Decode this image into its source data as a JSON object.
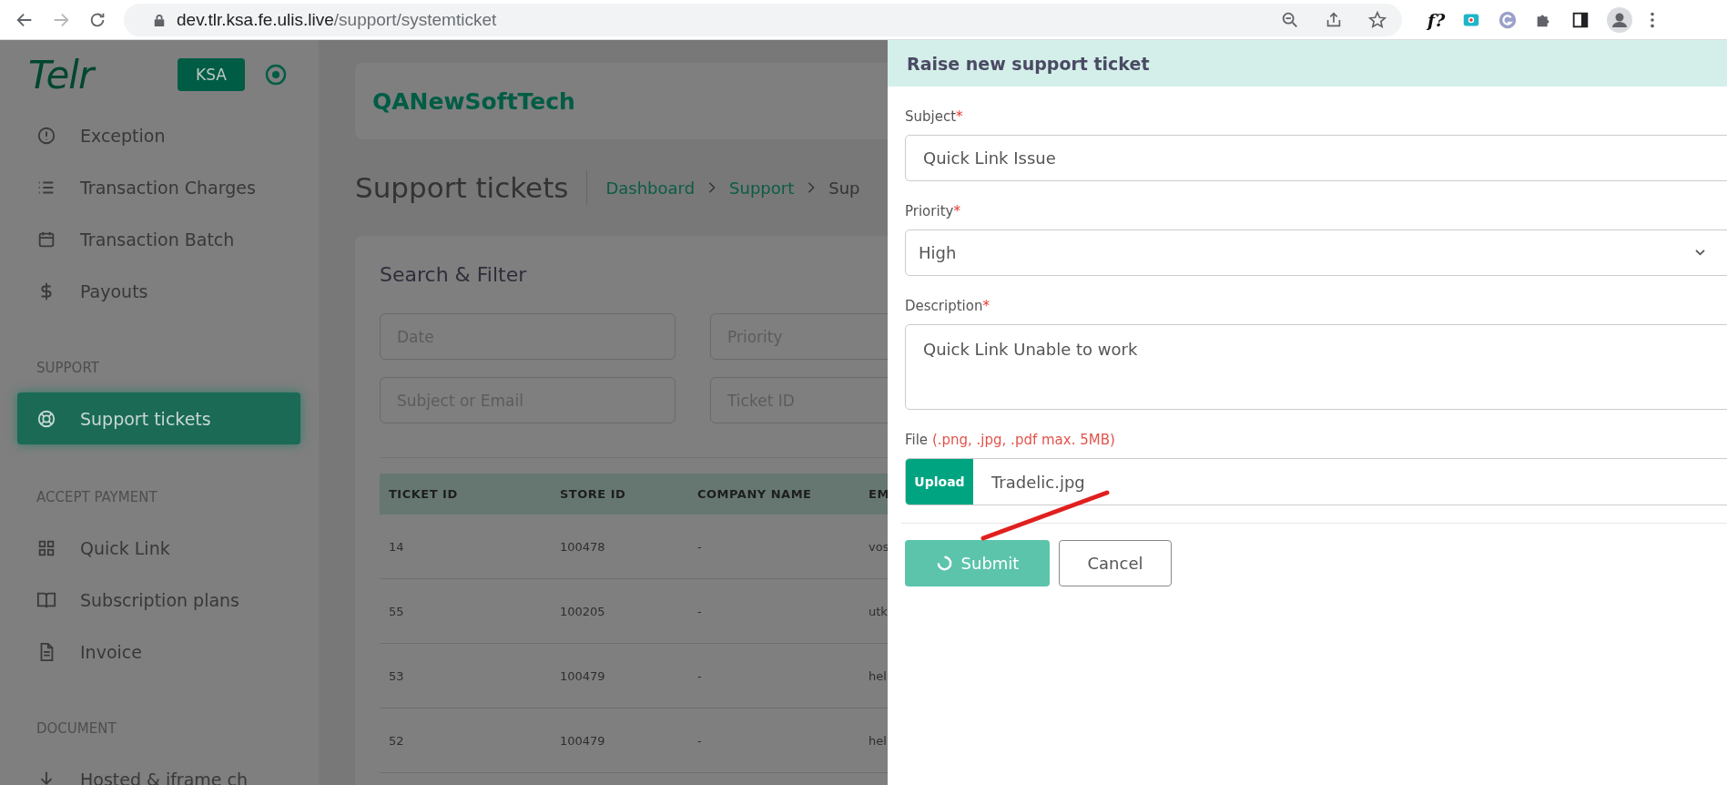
{
  "browser": {
    "url_domain": "dev.tlr.ksa.fe.ulis.live",
    "url_path": "/support/systemticket",
    "forward_disabled": true,
    "extension_label": "f?"
  },
  "sidebar": {
    "logo": "Telr",
    "region": "KSA",
    "entries": [
      {
        "kind": "item",
        "label": "Exception",
        "selected": false
      },
      {
        "kind": "item",
        "label": "Transaction Charges",
        "selected": false
      },
      {
        "kind": "item",
        "label": "Transaction Batch",
        "selected": false
      },
      {
        "kind": "item",
        "label": "Payouts",
        "selected": false
      },
      {
        "kind": "section",
        "label": "SUPPORT"
      },
      {
        "kind": "item",
        "label": "Support tickets",
        "selected": true
      },
      {
        "kind": "section",
        "label": "ACCEPT PAYMENT"
      },
      {
        "kind": "item",
        "label": "Quick Link",
        "selected": false
      },
      {
        "kind": "item",
        "label": "Subscription plans",
        "selected": false
      },
      {
        "kind": "item",
        "label": "Invoice",
        "selected": false
      },
      {
        "kind": "section",
        "label": "DOCUMENT"
      },
      {
        "kind": "item",
        "label": "Hosted & iframe ch",
        "selected": false
      }
    ]
  },
  "header": {
    "company": "QANewSoftTech"
  },
  "page": {
    "title": "Support tickets",
    "breadcrumb": [
      {
        "label": "Dashboard",
        "link": true
      },
      {
        "label": "Support",
        "link": true
      },
      {
        "label": "Sup",
        "link": false
      }
    ]
  },
  "filter": {
    "title": "Search & Filter",
    "fields": [
      {
        "placeholder": "Date"
      },
      {
        "placeholder": "Priority"
      },
      {
        "placeholder": "Subject or Email"
      },
      {
        "placeholder": "Ticket ID"
      }
    ]
  },
  "table": {
    "columns": [
      "TICKET ID",
      "STORE ID",
      "COMPANY NAME",
      "EM"
    ],
    "rows": [
      [
        "14",
        "100478",
        "-",
        "vos"
      ],
      [
        "55",
        "100205",
        "-",
        "utk"
      ],
      [
        "53",
        "100479",
        "-",
        "hel"
      ],
      [
        "52",
        "100479",
        "-",
        "hel"
      ]
    ]
  },
  "panel": {
    "title": "Raise new support ticket",
    "subject": {
      "label": "Subject",
      "required_mark": "*",
      "value": "Quick Link Issue"
    },
    "priority": {
      "label": "Priority",
      "required_mark": "*",
      "value": "High"
    },
    "description": {
      "label": "Description",
      "required_mark": "*",
      "value": "Quick Link Unable to work"
    },
    "file": {
      "label": "File",
      "hint": "(.png, .jpg, .pdf max. 5MB)",
      "button": "Upload",
      "value": "Tradelic.jpg"
    },
    "submit": {
      "label": "Submit",
      "loading": true
    },
    "cancel": {
      "label": "Cancel"
    }
  }
}
